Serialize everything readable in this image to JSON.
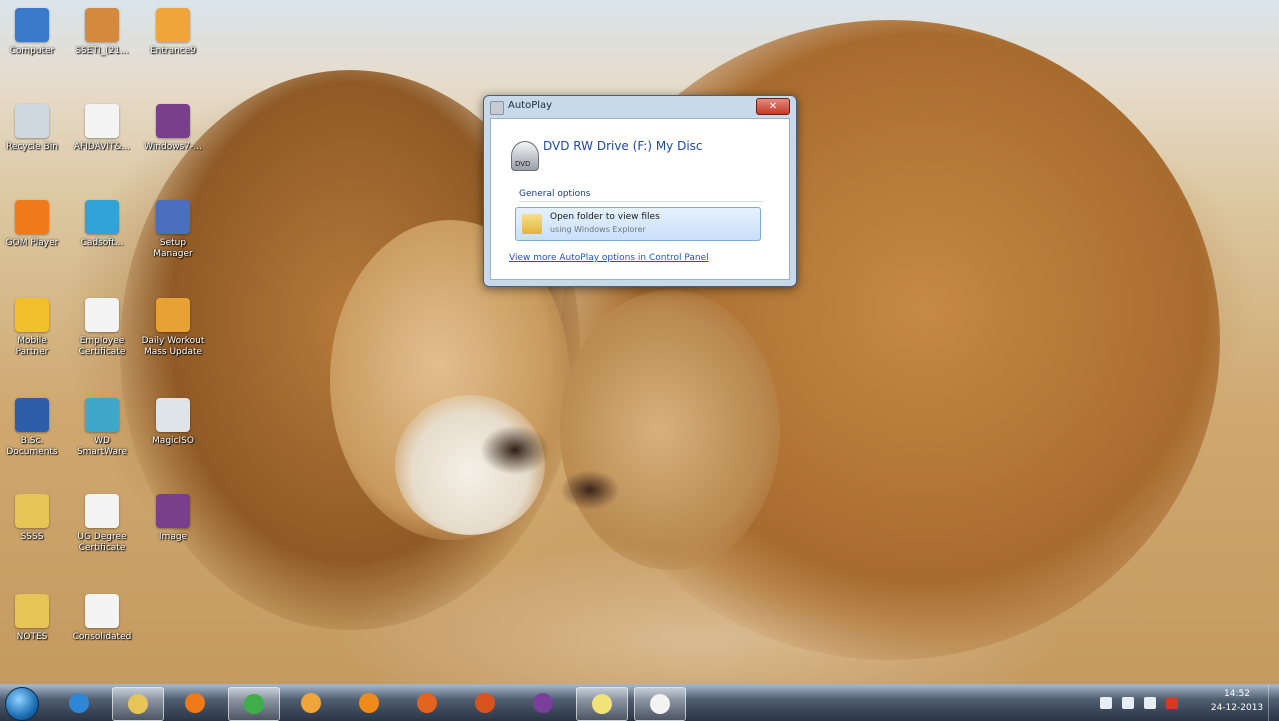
{
  "desktop": {
    "icons": [
      {
        "label": "Computer",
        "icon": "computer-icon",
        "color": "#3a78c9"
      },
      {
        "label": "SSETI_(21...",
        "icon": "grid-folder-icon",
        "color": "#d48a3c"
      },
      {
        "label": "Entrance9",
        "icon": "paint-app-icon",
        "color": "#f0a53a"
      },
      {
        "label": "Recycle Bin",
        "icon": "recycle-bin-icon",
        "color": "#cfd8e0"
      },
      {
        "label": "AFIDAVIT&...",
        "icon": "document-icon",
        "color": "#f4f4f4"
      },
      {
        "label": "Windows7-...",
        "icon": "film-icon",
        "color": "#7a3f8a"
      },
      {
        "label": "GOM Player",
        "icon": "media-player-icon",
        "color": "#f07a1a"
      },
      {
        "label": "Cadsoft...",
        "icon": "triangle-app-icon",
        "color": "#2fa3d6"
      },
      {
        "label": "Setup Manager",
        "icon": "setup-icon",
        "color": "#4b6fbf"
      },
      {
        "label": "Mobile Partner",
        "icon": "mobile-partner-icon",
        "color": "#f2c02a"
      },
      {
        "label": "Employee Certificate",
        "icon": "document-icon",
        "color": "#f4f4f4"
      },
      {
        "label": "Daily Workout Mass Update",
        "icon": "workout-app-icon",
        "color": "#e8a233"
      },
      {
        "label": "B.Sc. Documents",
        "icon": "word-document-icon",
        "color": "#2e5eaa"
      },
      {
        "label": "WD SmartWare",
        "icon": "wd-app-icon",
        "color": "#3fa7c9"
      },
      {
        "label": "MagicISO",
        "icon": "cd-icon",
        "color": "#dfe3ea"
      },
      {
        "label": "SSSS",
        "icon": "folder-icon",
        "color": "#e6c456"
      },
      {
        "label": "UG Degree Certificate",
        "icon": "document-icon",
        "color": "#f4f4f4"
      },
      {
        "label": "Image",
        "icon": "film-icon",
        "color": "#7a3f8a"
      },
      {
        "label": "NOTES",
        "icon": "folder-icon",
        "color": "#e6c456"
      },
      {
        "label": "Consolidated",
        "icon": "document-icon",
        "color": "#f4f4f4"
      }
    ]
  },
  "autoplay": {
    "title": "AutoPlay",
    "close_label": "✕",
    "drive_icon_label": "DVD",
    "heading": "DVD RW Drive (F:) My Disc",
    "section_label": "General options",
    "option_title": "Open folder to view files",
    "option_subtitle": "using Windows Explorer",
    "link_text": "View more AutoPlay options in Control Panel"
  },
  "taskbar": {
    "items": [
      {
        "name": "internet-explorer-icon",
        "color": "#2f86d6",
        "active": false
      },
      {
        "name": "windows-explorer-icon",
        "color": "#e6c456",
        "active": true
      },
      {
        "name": "media-player-icon",
        "color": "#f07a1a",
        "active": false
      },
      {
        "name": "chrome-icon",
        "color": "#3fae4a",
        "active": true
      },
      {
        "name": "paint-icon",
        "color": "#f0a53a",
        "active": false
      },
      {
        "name": "vlc-icon",
        "color": "#f08a1a",
        "active": false
      },
      {
        "name": "firefox-icon",
        "color": "#e3641f",
        "active": false
      },
      {
        "name": "matlab-icon",
        "color": "#d9531e",
        "active": false
      },
      {
        "name": "onenote-icon",
        "color": "#7a3f9a",
        "active": false
      },
      {
        "name": "sticky-notes-icon",
        "color": "#f1e27a",
        "active": true
      },
      {
        "name": "document-viewer-icon",
        "color": "#f4f4f4",
        "active": true
      }
    ],
    "clock": {
      "time": "14:52",
      "date": "24-12-2013"
    },
    "tray_icons": [
      "flag-icon",
      "network-icon",
      "volume-icon",
      "antivirus-icon"
    ]
  }
}
